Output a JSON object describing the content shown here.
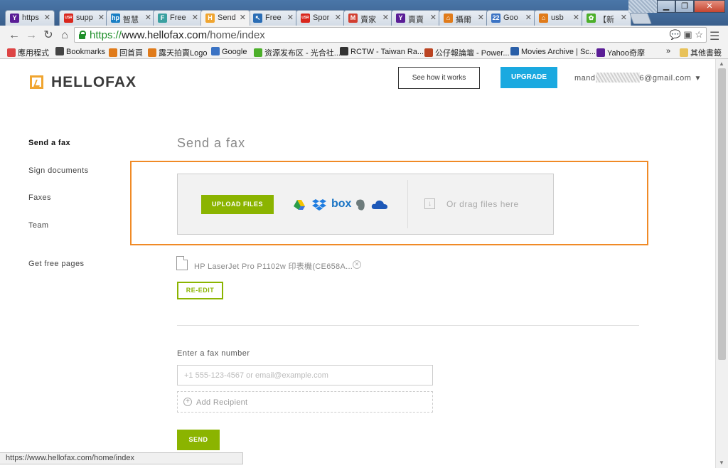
{
  "browser": {
    "tabs": [
      {
        "label": "https",
        "icon": "yahoo-icon",
        "color": "#5a1d96",
        "glyph": "Y"
      },
      {
        "label": "supp",
        "icon": "usr-icon",
        "color": "#d9261c",
        "glyph": "USR"
      },
      {
        "label": "智慧",
        "icon": "hp-icon",
        "color": "#1a7fc4",
        "glyph": "hp"
      },
      {
        "label": "Free",
        "icon": "free-icon",
        "color": "#3aa0a0",
        "glyph": "F"
      },
      {
        "label": "Send",
        "icon": "hellofax-icon",
        "color": "#f0a530",
        "glyph": "H",
        "active": true
      },
      {
        "label": "Free",
        "icon": "cursor-icon",
        "color": "#2a6db5",
        "glyph": "↖"
      },
      {
        "label": "Spor",
        "icon": "usr-icon",
        "color": "#d9261c",
        "glyph": "USR"
      },
      {
        "label": "賣家",
        "icon": "gmail-icon",
        "color": "#d23f31",
        "glyph": "M"
      },
      {
        "label": "賣賣",
        "icon": "yahoo-icon",
        "color": "#5a1d96",
        "glyph": "Y"
      },
      {
        "label": "攝爾",
        "icon": "home-icon",
        "color": "#e07b1a",
        "glyph": "⌂"
      },
      {
        "label": "Goo",
        "icon": "calendar-icon",
        "color": "#3b73c4",
        "glyph": "22"
      },
      {
        "label": "usb",
        "icon": "home-icon",
        "color": "#e07b1a",
        "glyph": "⌂"
      },
      {
        "label": "【新",
        "icon": "leaf-icon",
        "color": "#4caf2a",
        "glyph": "✿"
      }
    ],
    "url_scheme": "https://",
    "url_host": "www.hellofax.com",
    "url_path": "/home/index",
    "bookmarks": [
      {
        "label": "應用程式",
        "icon": "apps-icon",
        "color": "#d44"
      },
      {
        "label": "Bookmarks",
        "icon": "star-icon",
        "color": "#444"
      },
      {
        "label": "回首頁",
        "icon": "home-icon",
        "color": "#e07b1a"
      },
      {
        "label": "露天拍賣Logo",
        "icon": "home-icon",
        "color": "#e07b1a"
      },
      {
        "label": "Google",
        "icon": "google-icon",
        "color": "#3b73c4"
      },
      {
        "label": "资源发布区 - 光合社...",
        "icon": "leaf-icon",
        "color": "#4caf2a"
      },
      {
        "label": "RCTW - Taiwan Ra...",
        "icon": "car-icon",
        "color": "#333"
      },
      {
        "label": "公仔報論壇 - Power...",
        "icon": "forum-icon",
        "color": "#b42"
      },
      {
        "label": "Movies Archive | Sc...",
        "icon": "movie-icon",
        "color": "#2a5fa8"
      },
      {
        "label": "Yahoo奇摩",
        "icon": "yahoo-icon",
        "color": "#5a1d96"
      }
    ],
    "more_bookmarks": "»",
    "other_bookmarks": "其他書籤",
    "status_url": "https://www.hellofax.com/home/index"
  },
  "header": {
    "logo_text": "HELLOFAX",
    "how_label": "See how it works",
    "upgrade_label": "UPGRADE",
    "account_prefix": "mand",
    "account_suffix": "6@gmail.com"
  },
  "sidebar": {
    "items": [
      {
        "label": "Send a fax",
        "active": true
      },
      {
        "label": "Sign documents"
      },
      {
        "label": "Faxes"
      },
      {
        "label": "Team"
      },
      {
        "label": "Get free pages"
      }
    ]
  },
  "main": {
    "title": "Send a fax",
    "upload_label": "UPLOAD FILES",
    "drag_text": "Or drag files here",
    "file_name": "HP LaserJet Pro P1102w 印表機(CE658A...",
    "reedit_label": "RE-EDIT",
    "fax_label": "Enter a fax number",
    "fax_placeholder": "+1 555-123-4567 or email@example.com",
    "fax_value": "",
    "add_recipient": "Add Recipient",
    "send_label": "SEND",
    "box_text": "box"
  },
  "colors": {
    "accent_green": "#8bb400",
    "upgrade_blue": "#1aa9e0",
    "highlight_orange": "#f08a26",
    "logo_orange": "#f0a530"
  }
}
